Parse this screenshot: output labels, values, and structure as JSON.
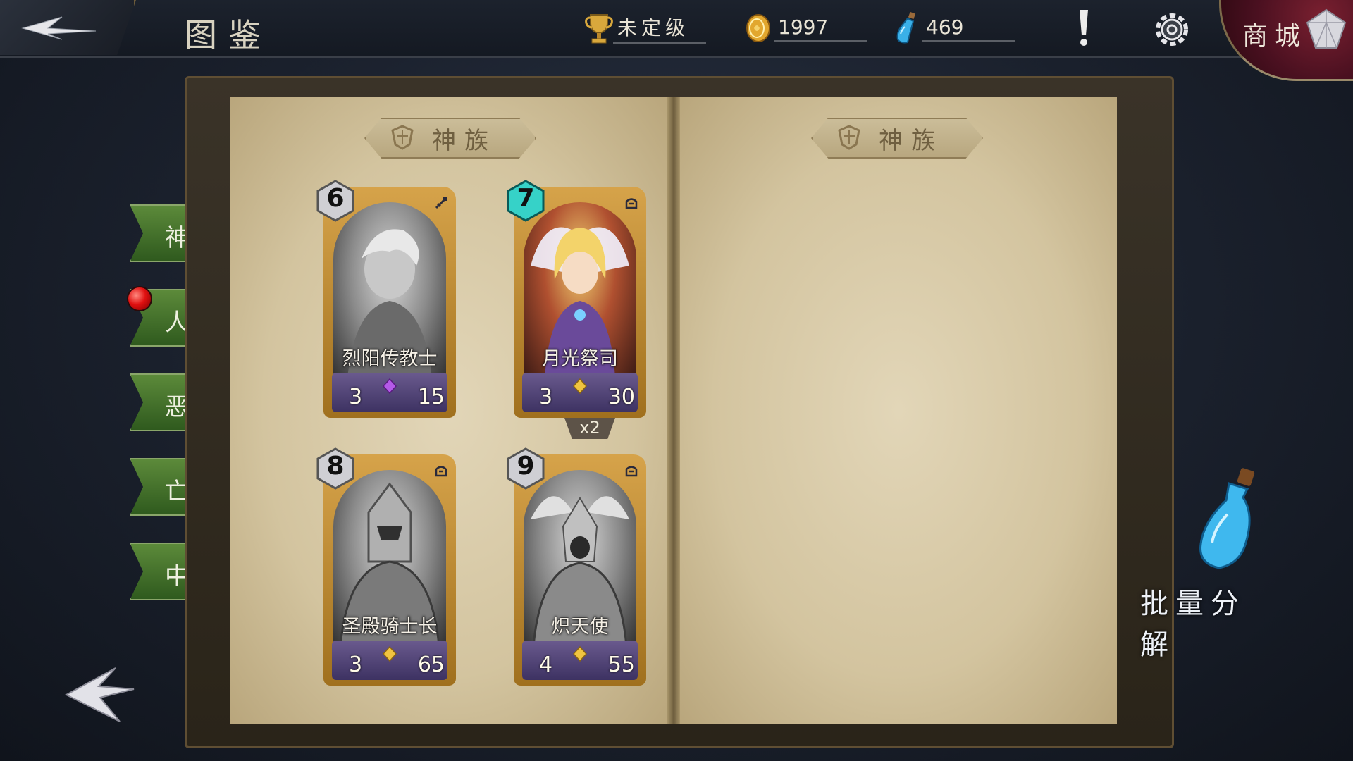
{
  "header": {
    "title": "图鉴",
    "rank_label": "未定级",
    "gold": "1997",
    "potion": "469",
    "shop_label": "商城"
  },
  "book": {
    "left_page_banner": "神族",
    "right_page_banner": "神族"
  },
  "tabs": [
    {
      "label": "神族",
      "selected": true
    },
    {
      "label": "人族",
      "has_notification": true
    },
    {
      "label": "恶魔"
    },
    {
      "label": "亡灵"
    },
    {
      "label": "中立"
    }
  ],
  "cards": [
    {
      "cost": "6",
      "name": "烈阳传教士",
      "attack": "3",
      "health": "15",
      "owned": false,
      "gem": "purple"
    },
    {
      "cost": "7",
      "name": "月光祭司",
      "attack": "3",
      "health": "30",
      "owned": true,
      "count": "x2",
      "gem": "gold"
    },
    {
      "cost": "8",
      "name": "圣殿骑士长",
      "attack": "3",
      "health": "65",
      "owned": false,
      "gem": "gold"
    },
    {
      "cost": "9",
      "name": "炽天使",
      "attack": "4",
      "health": "55",
      "owned": false,
      "gem": "gold"
    }
  ],
  "bulk": {
    "label": "批量分解"
  },
  "icons": {
    "back": "back-arrow-icon",
    "trophy": "trophy-icon",
    "gold": "gold-coin-icon",
    "potion": "potion-icon",
    "alert": "exclamation-icon",
    "settings": "gear-icon",
    "shop": "gem-icon"
  },
  "colors": {
    "tab_green": "#3f6e28",
    "parchment": "#d9caa4",
    "card_gold": "#c48f34",
    "shop_red": "#5a1424"
  }
}
